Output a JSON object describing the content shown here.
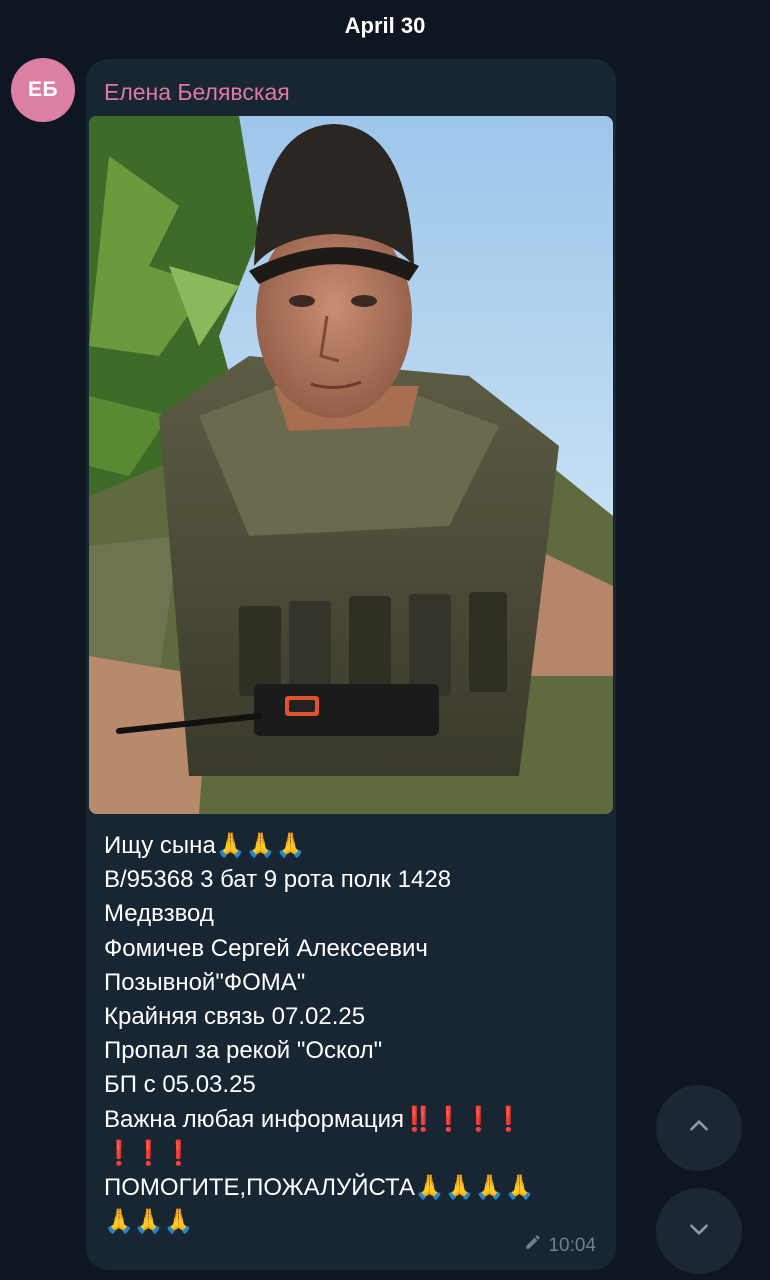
{
  "chat": {
    "date_separator": "April 30"
  },
  "message": {
    "avatar_initials": "ЕБ",
    "sender_name": "Елена Белявская",
    "photo_alt": "",
    "lines": [
      "Ищу сына🙏🙏🙏",
      "В/95368 3 бат 9 рота полк 1428",
      "Медвзвод",
      "Фомичев Сергей Алексеевич",
      "Позывной\"ФОМА\"",
      "Крайняя связь 07.02.25",
      "Пропал за рекой \"Оскол\"",
      "БП с 05.03.25",
      "Важна любая информация‼️❗️❗️❗️",
      "❗️❗️❗️",
      "ПОМОГИТЕ,ПОЖАЛУЙСТА🙏🙏🙏🙏",
      "🙏🙏🙏"
    ],
    "time": "10:04",
    "edited_icon": "pencil-icon"
  },
  "controls": {
    "scroll_up_icon": "chevron-up-icon",
    "scroll_down_icon": "chevron-down-icon"
  },
  "colors": {
    "background": "#0e1621",
    "bubble": "#182533",
    "sender_name": "#e0799f",
    "avatar": "#dc7fa5",
    "meta_text": "#6d7f8f",
    "fab_bg": "#1c2733"
  }
}
